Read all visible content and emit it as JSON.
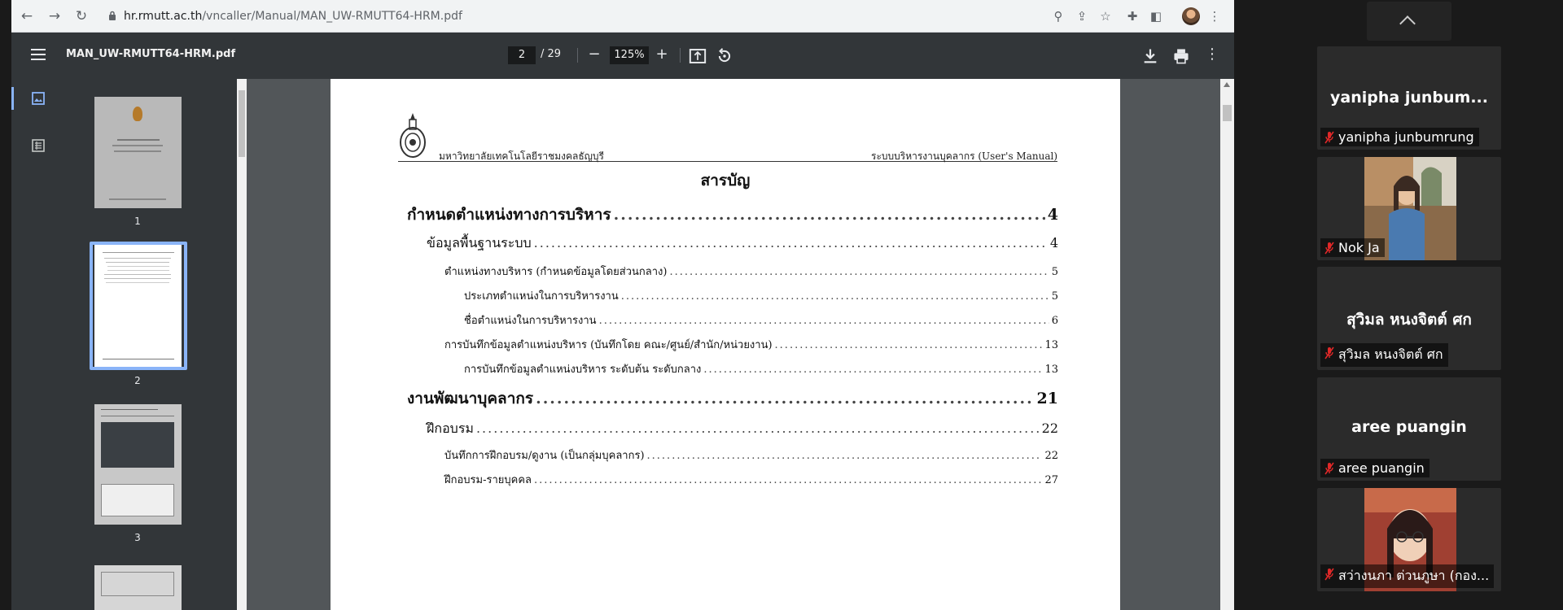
{
  "browser": {
    "url_host": "hr.rmutt.ac.th",
    "url_path": "/vncaller/Manual/MAN_UW-RMUTT64-HRM.pdf"
  },
  "pdf_toolbar": {
    "title": "MAN_UW-RMUTT64-HRM.pdf",
    "current_page": "2",
    "total_pages": "/ 29",
    "zoom": "125%"
  },
  "thumbnails": [
    {
      "num": "1"
    },
    {
      "num": "2"
    },
    {
      "num": "3"
    }
  ],
  "document": {
    "university": "มหาวิทยาลัยเทคโนโลยีราชมงคลธัญบุรี",
    "system": "ระบบบริหารงานบุคลากร (User's Manual)",
    "toc_title": "สารบัญ",
    "toc": [
      {
        "label": "กำหนดตำแหน่งทางการบริหาร",
        "page": "4"
      },
      {
        "label": "ข้อมูลพื้นฐานระบบ",
        "page": "4"
      },
      {
        "label": "ตำแหน่งทางบริหาร (กำหนดข้อมูลโดยส่วนกลาง)",
        "page": "5"
      },
      {
        "label": "ประเภทตำแหน่งในการบริหารงาน",
        "page": "5"
      },
      {
        "label": "ชื่อตำแหน่งในการบริหารงาน",
        "page": "6"
      },
      {
        "label": "การบันทึกข้อมูลตำแหน่งบริหาร (บันทึกโดย คณะ/ศูนย์/สำนัก/หน่วยงาน)",
        "page": "13"
      },
      {
        "label": "การบันทึกข้อมูลตำแหน่งบริหาร ระดับต้น ระดับกลาง",
        "page": "13"
      },
      {
        "label": "งานพัฒนาบุคลากร",
        "page": "21"
      },
      {
        "label": "ฝึกอบรม",
        "page": "22"
      },
      {
        "label": "บันทึกการฝึกอบรม/ดูงาน (เป็นกลุ่มบุคลากร)",
        "page": "22"
      },
      {
        "label": "ฝึกอบรม-รายบุคคล",
        "page": "27"
      }
    ]
  },
  "participants": [
    {
      "display": "yanipha  junbum...",
      "tag": "yanipha junbumrung"
    },
    {
      "display": "",
      "tag": "Nok Ja"
    },
    {
      "display": "สุวิมล หนงจิตต์ ศก",
      "tag": "สุวิมล หนงจิตต์ ศก"
    },
    {
      "display": "aree puangin",
      "tag": "aree puangin"
    },
    {
      "display": "",
      "tag": "สว่างนภา ต่วนภูษา (กอง..."
    }
  ],
  "colors": {
    "accent": "#8ab4f8",
    "pdf_toolbar": "#323639",
    "viewer_bg": "#525659",
    "mute_red": "#e02828"
  }
}
